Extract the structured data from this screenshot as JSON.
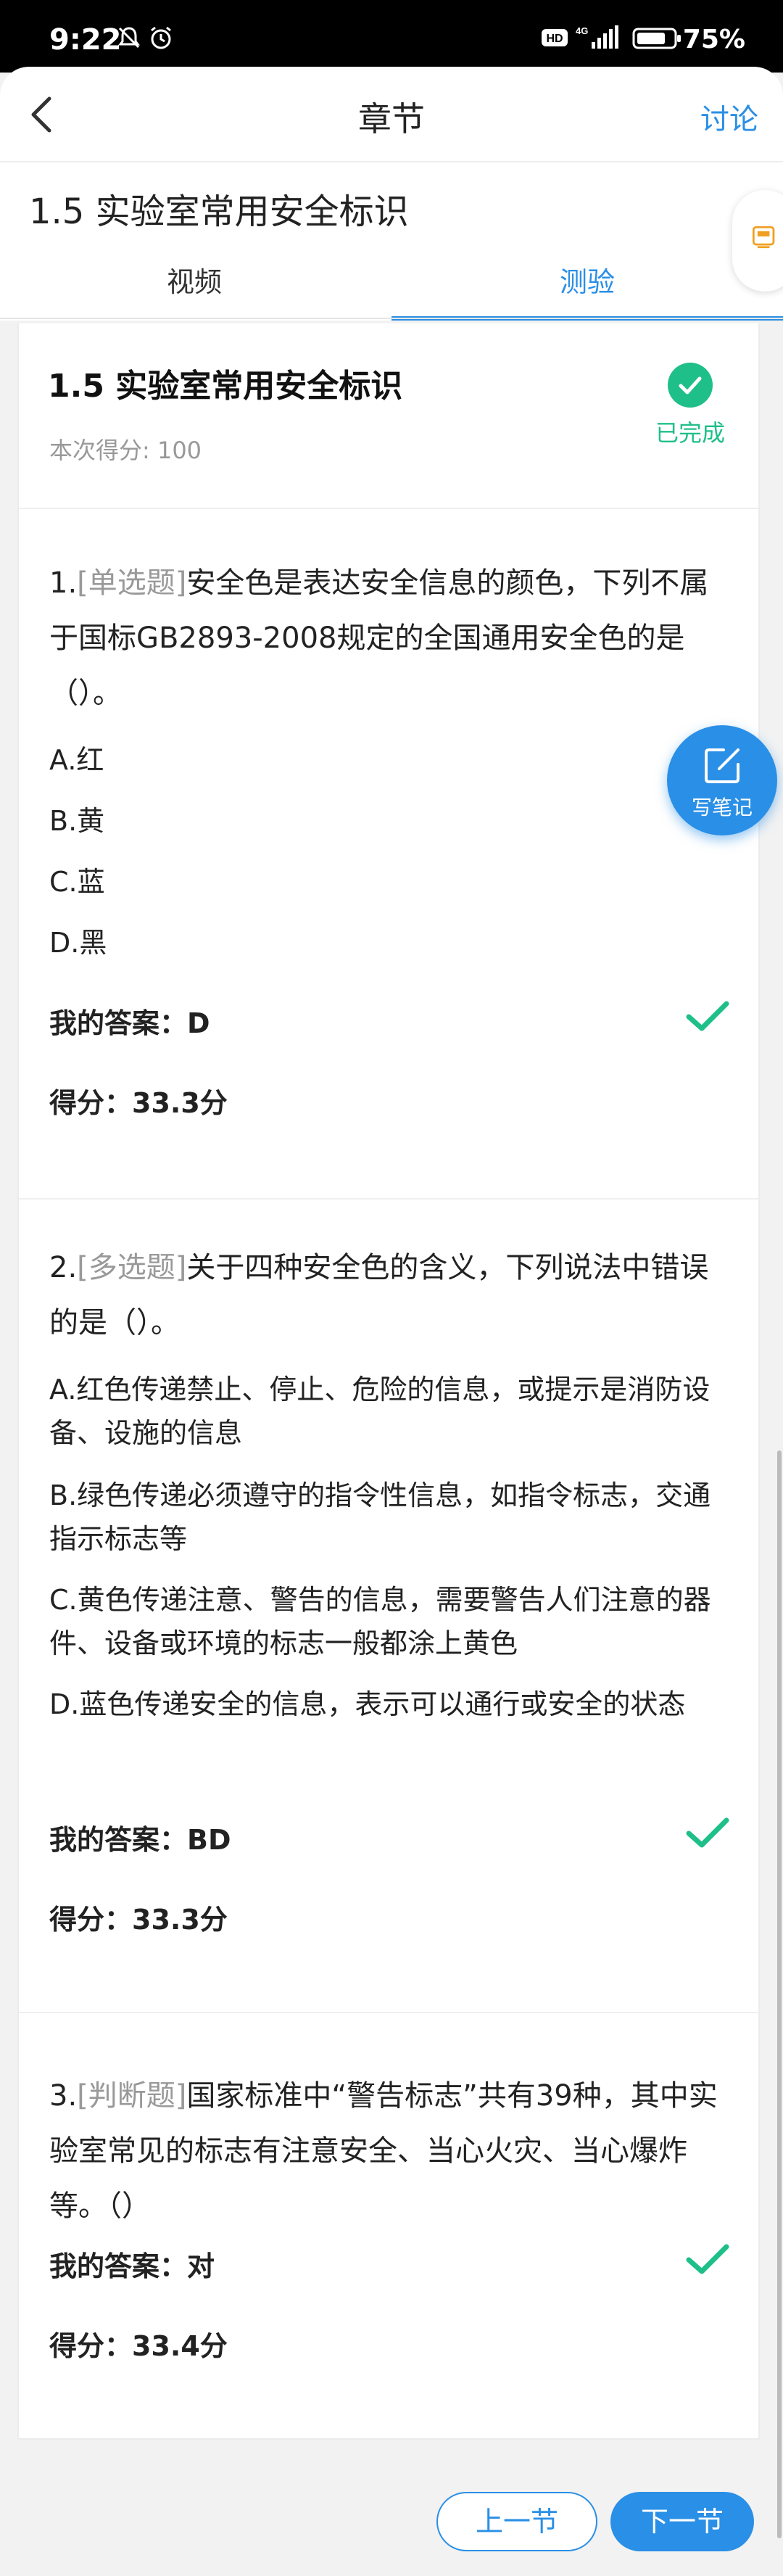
{
  "status_bar": {
    "time": "9:22",
    "battery": "75%",
    "network": "4G"
  },
  "nav": {
    "title": "章节",
    "discuss": "讨论"
  },
  "chapter": {
    "title": "1.5  实验室常用安全标识"
  },
  "tabs": [
    {
      "label": "视频",
      "active": false
    },
    {
      "label": "测验",
      "active": true
    }
  ],
  "section": {
    "title": "1.5 实验室常用安全标识",
    "score_text": "本次得分: 100",
    "status": "已完成"
  },
  "note_button": {
    "label": "写笔记"
  },
  "questions": [
    {
      "number": "1.",
      "type": "[单选题]",
      "text": "安全色是表达安全信息的颜色，下列不属于国标GB2893-2008规定的全国通用安全色的是（）。",
      "options": [
        "A.红",
        "B.黄",
        "C.蓝",
        "D.黑"
      ],
      "my_answer": "我的答案：D",
      "score": "得分：33.3分"
    },
    {
      "number": "2.",
      "type": "[多选题]",
      "text": "关于四种安全色的含义，下列说法中错误的是（）。",
      "options": [
        "A.红色传递禁止、停止、危险的信息，或提示是消防设备、设施的信息",
        "B.绿色传递必须遵守的指令性信息，如指令标志，交通指示标志等",
        "C.黄色传递注意、警告的信息，需要警告人们注意的器件、设备或环境的标志一般都涂上黄色",
        "D.蓝色传递安全的信息，表示可以通行或安全的状态"
      ],
      "my_answer": "我的答案：BD",
      "score": "得分：33.3分"
    },
    {
      "number": "3.",
      "type": "[判断题]",
      "text": "国家标准中“警告标志”共有39种，其中实验室常见的标志有注意安全、当心火灾、当心爆炸等。（）",
      "options": [],
      "my_answer": "我的答案：对",
      "score": "得分：33.4分"
    }
  ],
  "footer": {
    "prev": "上一节",
    "next": "下一节"
  },
  "colors": {
    "accent": "#2a8fe6",
    "success": "#1fbf8a",
    "muted": "#999999"
  }
}
